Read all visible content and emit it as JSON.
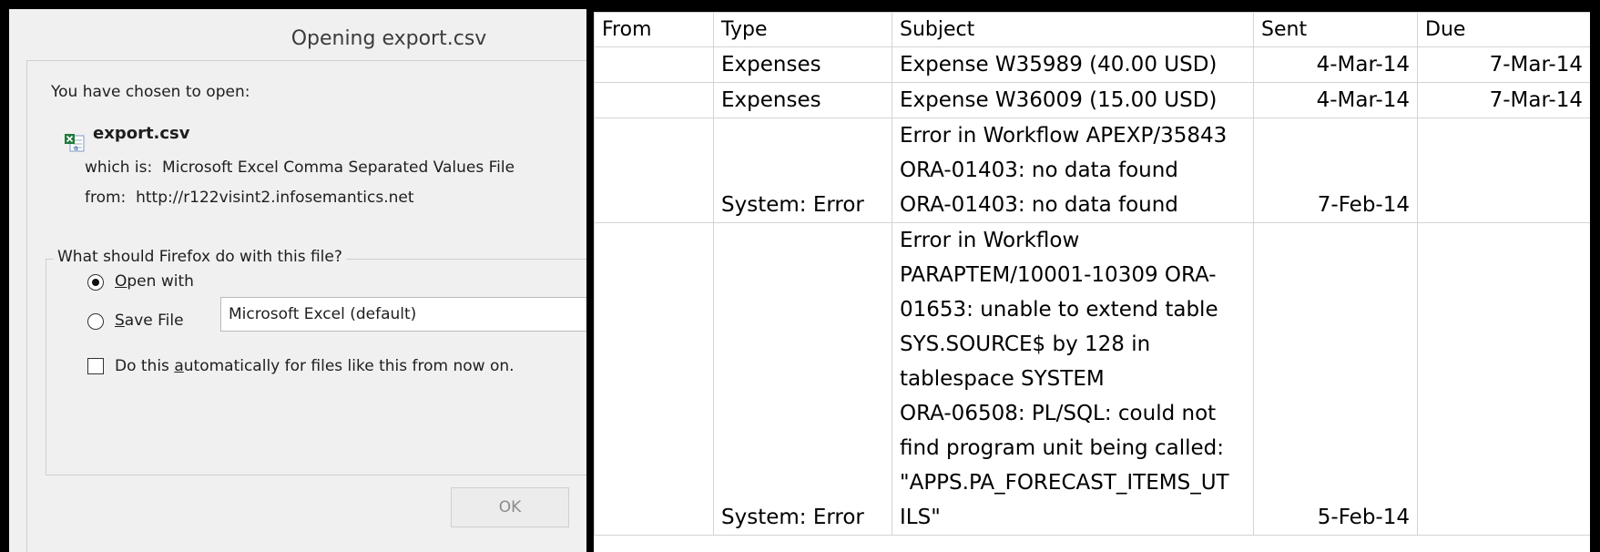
{
  "dialog": {
    "title": "Opening export.csv",
    "intro": "You have chosen to open:",
    "file_icon": "excel-csv-file-icon",
    "filename": "export.csv",
    "which_is_label": "which is:",
    "file_type": "Microsoft Excel Comma Separated Values File",
    "from_label": "from:",
    "from_url": "http://r122visint2.infosemantics.net",
    "question": "What should Firefox do with this file?",
    "open_with": {
      "label_first": "O",
      "label_rest": "pen with",
      "checked": true,
      "app": "Microsoft Excel (default)"
    },
    "save_file": {
      "label_first": "S",
      "label_rest": "ave File",
      "checked": false
    },
    "auto": {
      "label_pre": "Do this ",
      "label_u": "a",
      "label_post": "utomatically for files like this from now on.",
      "checked": false
    },
    "ok_label": "OK"
  },
  "sheet": {
    "headers": [
      "From",
      "Type",
      "Subject",
      "Sent",
      "Due"
    ],
    "rows": [
      {
        "from": "",
        "type": "Expenses",
        "subject": "Expense W35989 (40.00 USD)",
        "sent": "4-Mar-14",
        "due": "7-Mar-14"
      },
      {
        "from": "",
        "type": "Expenses",
        "subject": "Expense W36009 (15.00 USD)",
        "sent": "4-Mar-14",
        "due": "7-Mar-14"
      },
      {
        "from": "",
        "type": "System: Error",
        "subject_lines": [
          "Error in Workflow APEXP/35843",
          "ORA-01403: no data found",
          "ORA-01403: no data found"
        ],
        "sent": "7-Feb-14",
        "due": ""
      },
      {
        "from": "",
        "type": "System: Error",
        "subject_lines": [
          "Error in Workflow",
          "PARAPTEM/10001-10309 ORA-",
          "01653: unable to extend table",
          "SYS.SOURCE$ by 128 in",
          "tablespace SYSTEM",
          "ORA-06508: PL/SQL: could not",
          "find program unit being called:",
          "\"APPS.PA_FORECAST_ITEMS_UT",
          "ILS\""
        ],
        "sent": "5-Feb-14",
        "due": ""
      }
    ]
  }
}
